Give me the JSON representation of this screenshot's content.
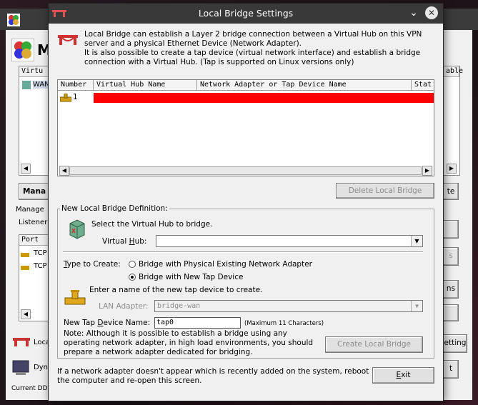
{
  "background": {
    "app_title_fragment": "M",
    "hub_list_header_left": "Virtu",
    "hub_list_header_right": "able",
    "hub_row_label": "WAN",
    "manage_button": "Mana",
    "right_button_fragment": "te",
    "manager_group_label": "Manage",
    "listener_label": "Listener",
    "port_header": "Port",
    "listener_rows": [
      "TCP",
      "TCP"
    ],
    "right_button_fragment_2": "s",
    "right_button_fragment_3": "ns",
    "bottom_item_1": "Loca",
    "bottom_item_2": "Dyn",
    "right_button_fragment_4": "etting",
    "right_button_fragment_5": "t",
    "status_text": "Current DDN"
  },
  "dialog": {
    "title": "Local Bridge Settings",
    "intro": [
      "Local Bridge can establish a Layer 2 bridge connection between a Virtual Hub on this VPN",
      "server and a physical Ethernet Device (Network Adapter).",
      "It is also possible to create a tap device (virtual network interface) and establish a bridge",
      "connection with a Virtual Hub. (Tap is supported on Linux versions only)"
    ],
    "list": {
      "columns": [
        "Number",
        "Virtual Hub Name",
        "Network Adapter or Tap Device Name",
        "Stat"
      ],
      "rows": [
        {
          "number": "1"
        }
      ]
    },
    "delete_button": "Delete Local Bridge",
    "new_group_title": "New Local Bridge Definition:",
    "select_hub_prompt": "Select the Virtual Hub to bridge.",
    "virtual_hub_label": "Virtual Hub:",
    "virtual_hub_value": "",
    "type_label": "Type to Create:",
    "option_physical": "Bridge with Physical Existing Network Adapter",
    "option_tap": "Bridge with New Tap Device",
    "tap_prompt": "Enter a name of the new tap device to create.",
    "lan_adapter_label": "LAN Adapter:",
    "lan_adapter_value": "bridge-wan",
    "tap_name_label": "New Tap Device Name:",
    "tap_name_value": "tap0",
    "tap_name_hint": "(Maximum 11 Characters)",
    "note": [
      "Note: Although it is possible to establish a bridge using any",
      "operating network adapter, in high load environments, you should",
      "prepare a network adapter dedicated for bridging."
    ],
    "create_button": "Create Local Bridge",
    "footer": [
      "If a network adapter doesn't appear which is recently added on the system, reboot",
      "the computer and re-open this screen."
    ],
    "exit_button": "Exit"
  },
  "colors": {
    "titlebar": "#393939",
    "redaction": "#ff0000",
    "dialog_bg": "#f0f0f0"
  }
}
